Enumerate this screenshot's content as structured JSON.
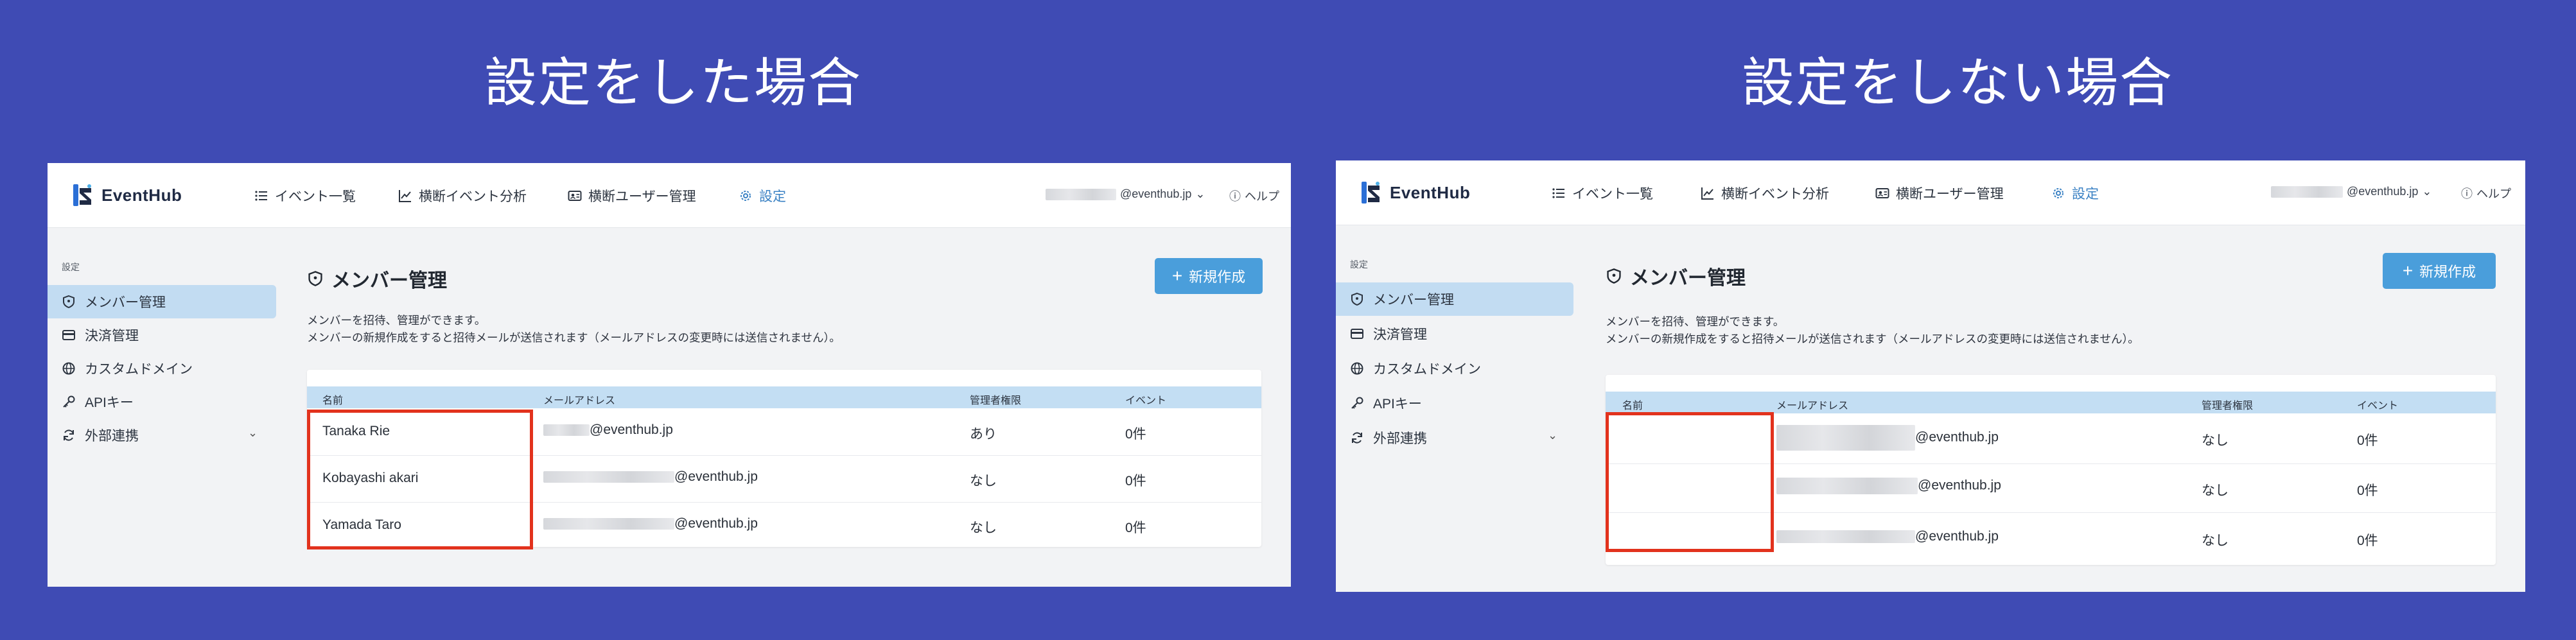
{
  "panels": [
    {
      "heading": "設定をした場合",
      "brand": "EventHub",
      "nav": [
        "イベント一覧",
        "横断イベント分析",
        "横断ユーザー管理",
        "設定"
      ],
      "account_email": "@eventhub.jp",
      "help": "ヘルプ",
      "sidebar_heading": "設定",
      "sidebar": [
        "メンバー管理",
        "決済管理",
        "カスタムドメイン",
        "APIキー",
        "外部連携"
      ],
      "page_title": "メンバー管理",
      "description": [
        "メンバーを招待、管理ができます。",
        "メンバーの新規作成をすると招待メールが送信されます（メールアドレスの変更時には送信されません）。"
      ],
      "new_button": "新規作成",
      "columns": [
        "名前",
        "メールアドレス",
        "管理者権限",
        "イベント"
      ],
      "rows": [
        {
          "name": "Tanaka Rie",
          "email": "@eventhub.jp",
          "admin": "あり",
          "events": "0件"
        },
        {
          "name": "Kobayashi akari",
          "email": "@eventhub.jp",
          "admin": "なし",
          "events": "0件"
        },
        {
          "name": "Yamada Taro",
          "email": "@eventhub.jp",
          "admin": "なし",
          "events": "0件"
        }
      ]
    },
    {
      "heading": "設定をしない場合",
      "brand": "EventHub",
      "nav": [
        "イベント一覧",
        "横断イベント分析",
        "横断ユーザー管理",
        "設定"
      ],
      "account_email": "@eventhub.jp",
      "help": "ヘルプ",
      "sidebar_heading": "設定",
      "sidebar": [
        "メンバー管理",
        "決済管理",
        "カスタムドメイン",
        "APIキー",
        "外部連携"
      ],
      "page_title": "メンバー管理",
      "description": [
        "メンバーを招待、管理ができます。",
        "メンバーの新規作成をすると招待メールが送信されます（メールアドレスの変更時には送信されません）。"
      ],
      "new_button": "新規作成",
      "columns": [
        "名前",
        "メールアドレス",
        "管理者権限",
        "イベント"
      ],
      "rows": [
        {
          "name": "",
          "email": "@eventhub.jp",
          "admin": "なし",
          "events": "0件"
        },
        {
          "name": "",
          "email": "@eventhub.jp",
          "admin": "なし",
          "events": "0件"
        },
        {
          "name": "",
          "email": "@eventhub.jp",
          "admin": "なし",
          "events": "0件"
        }
      ]
    }
  ],
  "colors": {
    "background": "#3f4bb4",
    "accent": "#4a9edb",
    "highlight": "#e2321d",
    "active_nav": "#3b82c4"
  }
}
